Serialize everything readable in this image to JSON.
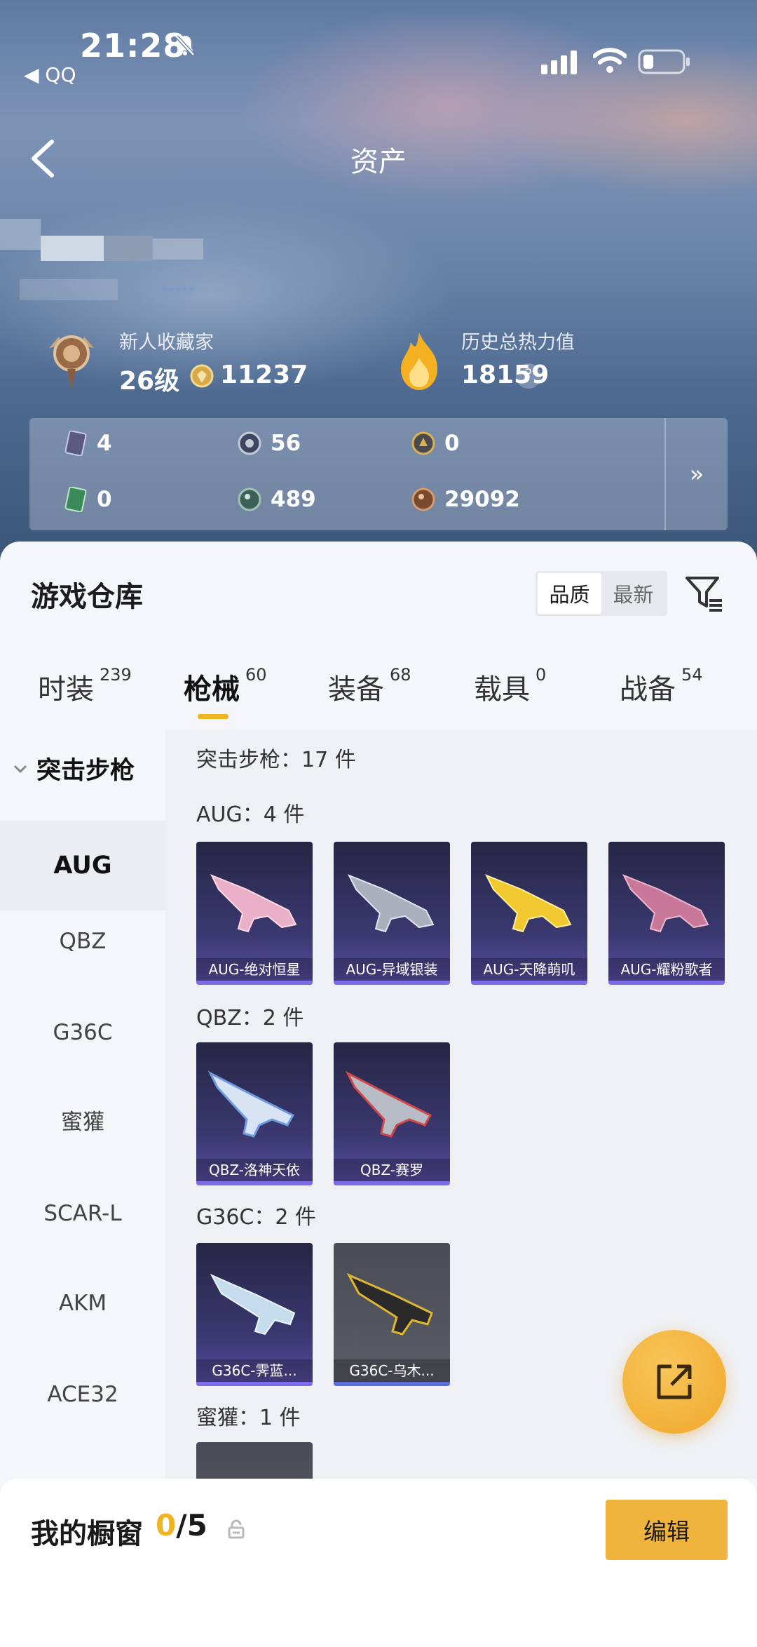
{
  "status_bar": {
    "time": "21:28",
    "back_app": "◀ QQ"
  },
  "nav": {
    "title": "资产"
  },
  "profile": {
    "blurred_link": "·····"
  },
  "stats": {
    "collector_title": "新人收藏家",
    "level": "26级",
    "collector_points": "11237",
    "heat_label": "历史总热力值",
    "heat_value": "18159",
    "help": "?"
  },
  "resources": {
    "row1": [
      "4",
      "56",
      "0"
    ],
    "row2": [
      "0",
      "489",
      "29092"
    ],
    "more": "»"
  },
  "warehouse": {
    "title": "游戏仓库",
    "sort_options": [
      "品质",
      "最新"
    ],
    "tabs": [
      {
        "label": "时装",
        "count": "239"
      },
      {
        "label": "枪械",
        "count": "60"
      },
      {
        "label": "装备",
        "count": "68"
      },
      {
        "label": "载具",
        "count": "0"
      },
      {
        "label": "战备",
        "count": "54"
      }
    ]
  },
  "sidebar": {
    "heading": "突击步枪",
    "items": [
      "AUG",
      "QBZ",
      "G36C",
      "蜜獾",
      "SCAR-L",
      "AKM",
      "ACE32"
    ]
  },
  "content": {
    "category_total": "突击步枪：17 件",
    "groups": [
      {
        "label": "AUG：4 件",
        "items": [
          "AUG-绝对恒星",
          "AUG-异域银装",
          "AUG-天降萌叽",
          "AUG-耀粉歌者"
        ]
      },
      {
        "label": "QBZ：2 件",
        "items": [
          "QBZ-洛神天依",
          "QBZ-赛罗"
        ]
      },
      {
        "label": "G36C：2 件",
        "items": [
          "G36C-霁蓝...",
          "G36C-乌木..."
        ]
      },
      {
        "label": "蜜獾：1 件",
        "items": []
      }
    ]
  },
  "showcase": {
    "title": "我的橱窗",
    "current": "0",
    "total": "/5",
    "edit_label": "编辑"
  },
  "colors": {
    "accent": "#f0b322",
    "card_purple": "#3a3870",
    "link_blue": "#5b8ee6"
  }
}
